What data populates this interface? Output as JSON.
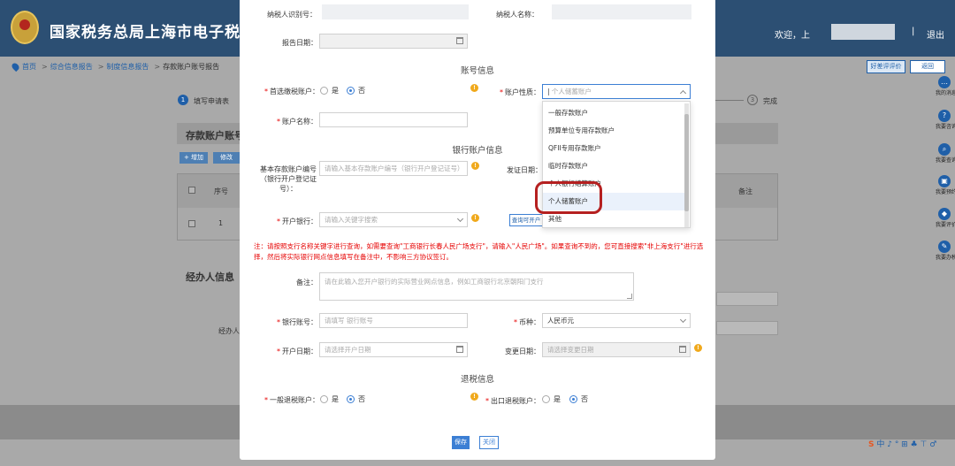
{
  "header": {
    "site_title": "国家税务总局上海市电子税务局",
    "welcome": "欢迎，上",
    "separator": "|",
    "logout": "退出"
  },
  "breadcrumb": {
    "home": "首页",
    "sep": ">",
    "level1": "综合信息报告",
    "level2": "制度信息报告",
    "current": "存款账户账号报告"
  },
  "top_actions": {
    "rate": "好差评评价",
    "back": "返回"
  },
  "steps": {
    "step1_num": "1",
    "step1_label": "填写申请表",
    "step3_num": "3",
    "step3_label": "完成"
  },
  "background": {
    "panel_title": "存款账户账号",
    "add": "+ 增加",
    "edit": "修改",
    "col_index": "序号",
    "col_remark": "备注",
    "row_index": "1",
    "agent_title": "经办人信息",
    "agent_label": "经办人"
  },
  "right_rail": [
    {
      "icon": "chat-icon",
      "glyph": "…",
      "label": "我的消息"
    },
    {
      "icon": "question-icon",
      "glyph": "?",
      "label": "我要咨询"
    },
    {
      "icon": "search-icon",
      "glyph": "⌕",
      "label": "我要查询"
    },
    {
      "icon": "calendar-icon",
      "glyph": "▣",
      "label": "我要预约"
    },
    {
      "icon": "shield-icon",
      "glyph": "◆",
      "label": "我要评价"
    },
    {
      "icon": "pen-icon",
      "glyph": "✎",
      "label": "我要办税"
    }
  ],
  "ime": {
    "logo": "S",
    "text": "中 ♪ ° ⊞ ♣ ⊤ ♂"
  },
  "form": {
    "taxpayer_id_label": "纳税人识别号：",
    "taxpayer_name_label": "纳税人名称：",
    "report_date_label": "报告日期：",
    "sec_account": "账号信息",
    "preferred_label": "首选缴税账户：",
    "yes": "是",
    "no": "否",
    "nature_label": "账户性质：",
    "nature_placeholder": "个人储蓄账户",
    "account_name_label": "账户名称：",
    "sec_bank": "银行账户信息",
    "basic_account_label_l1": "基本存款账户编号",
    "basic_account_label_l2": "（银行开户登记证",
    "basic_account_label_l3": "号）：",
    "basic_account_placeholder": "请输入基本存款账户编号（银行开户登记证号）",
    "issue_date_label": "发证日期：",
    "open_bank_label": "开户银行：",
    "open_bank_placeholder": "请输入关键字搜索",
    "query_button": "查询可开户",
    "note": "注：请按照支行名称关键字进行查询，如需要查询\"工商银行长春人民广场支行\"，请输入\"人民广场\"。如果查询不到的，您可直接搜索\"非上海支行\"进行选择，然后将实际银行网点信息填写在备注中，不影响三方协议签订。",
    "remark_label": "备注：",
    "remark_placeholder": "请在此输入您开户银行的实际营业网点信息，例如工商银行北京朝阳门支行",
    "bank_account_label": "银行账号：",
    "bank_account_placeholder": "请填写 银行账号",
    "currency_label": "币种：",
    "currency_value": "人民币元",
    "open_date_label": "开户日期：",
    "open_date_placeholder": "请选择开户日期",
    "change_date_label": "变更日期：",
    "change_date_placeholder": "请选择变更日期",
    "sec_refund": "退税信息",
    "general_refund_label": "一般退税账户：",
    "export_refund_label": "出口退税账户：",
    "save": "保存",
    "close": "关闭"
  },
  "dropdown": {
    "options": [
      "一般存款账户",
      "预算单位专用存款账户",
      "QFII专用存款账户",
      "临时存款账户",
      "个人银行结算账户",
      "个人储蓄账户",
      "其他"
    ],
    "selected": "个人储蓄账户"
  },
  "colors": {
    "header_blue": "#2c4f73",
    "primary": "#3c7fd4",
    "required_red": "#e60000",
    "highlight_red": "#b52020",
    "warning": "#f0a91c"
  }
}
